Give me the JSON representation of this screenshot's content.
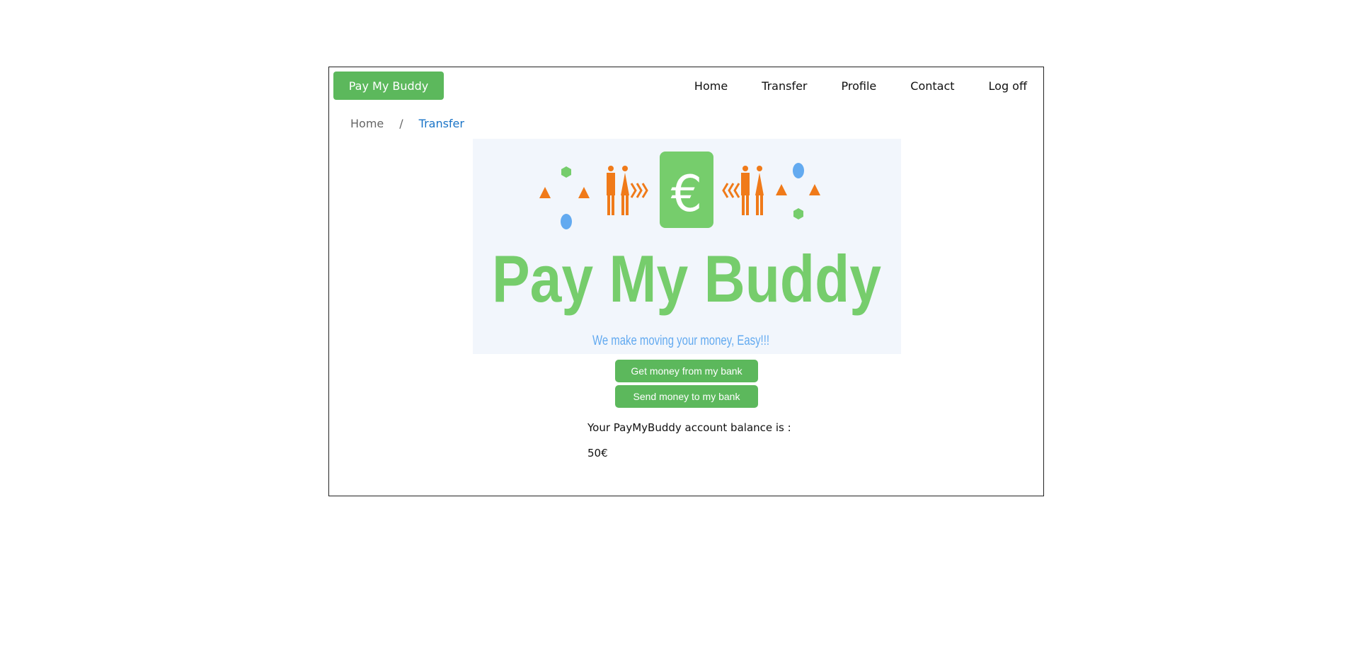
{
  "header": {
    "brand_label": "Pay My Buddy",
    "nav": {
      "home": "Home",
      "transfer": "Transfer",
      "profile": "Profile",
      "contact": "Contact",
      "logoff": "Log off"
    }
  },
  "breadcrumb": {
    "home": "Home",
    "separator": "/",
    "current": "Transfer"
  },
  "banner": {
    "logo_text": "Pay My Buddy",
    "tagline": "We make moving your money, Easy!!!",
    "currency_symbol": "€",
    "colors": {
      "green": "#76cd6c",
      "orange": "#f07a19",
      "blue": "#63aaf0",
      "background": "#f2f6fc"
    }
  },
  "actions": {
    "get_money": "Get money from my bank",
    "send_money": "Send money to my bank"
  },
  "balance": {
    "label": "Your PayMyBuddy account balance is :",
    "value": "50€"
  },
  "colors": {
    "accent": "#5cb85c",
    "link_active": "#1a74c7"
  }
}
